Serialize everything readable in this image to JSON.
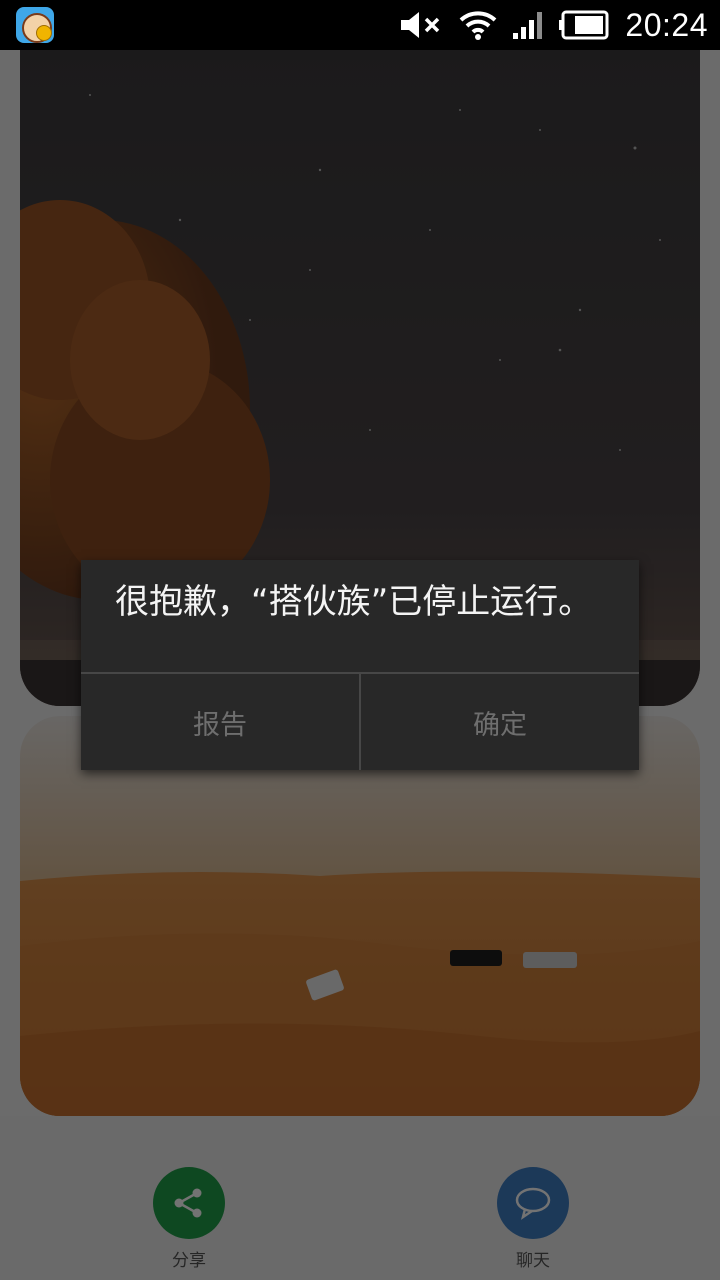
{
  "status_bar": {
    "time": "20:24",
    "icons": [
      "app-notification-icon",
      "mute-icon",
      "wifi-icon",
      "signal-icon",
      "battery-icon"
    ]
  },
  "cards": [
    {
      "scene": "night-sky-with-autumn-tree"
    },
    {
      "scene": "desert-dunes-with-suvs"
    }
  ],
  "actions": {
    "share_label": "分享",
    "chat_label": "聊天",
    "share_color": "#1fa049",
    "chat_color": "#3f7fc4"
  },
  "dialog": {
    "message": "很抱歉，“搭伙族”已停止运行。",
    "report_label": "报告",
    "ok_label": "确定"
  }
}
